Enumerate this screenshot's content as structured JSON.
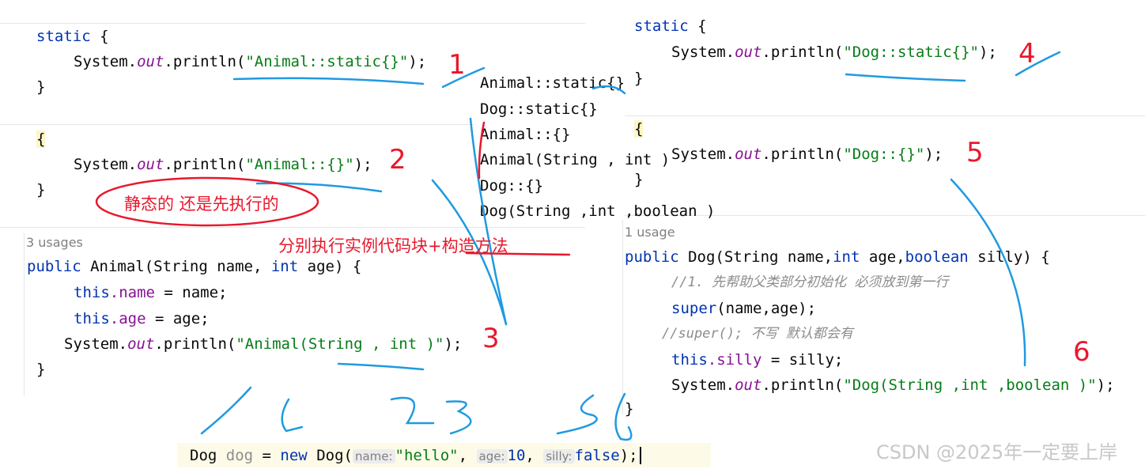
{
  "left": {
    "static_block": {
      "kw": "static",
      "open": " {",
      "sys": "System.",
      "out": "out",
      "println": ".println(",
      "str": "\"Animal::static{}\"",
      "end": ");",
      "close": "}"
    },
    "instance_block": {
      "open": "{",
      "sys": "System.",
      "out": "out",
      "println": ".println(",
      "str": "\"Animal::{}\"",
      "end": ");",
      "close": "}"
    },
    "usages": "3 usages",
    "ctor": {
      "kw_public": "public",
      "name": " Animal(String name, ",
      "kw_int": "int",
      "rest": " age) {",
      "l1_this": "this",
      "l1_field": ".name",
      "l1_rest": " = name;",
      "l2_this": "this",
      "l2_field": ".age",
      "l2_rest": " = age;",
      "sys": "System.",
      "out": "out",
      "println": ".println(",
      "str": "\"Animal(String , int )\"",
      "end": ");",
      "close": "}"
    }
  },
  "output": [
    "Animal::static{}",
    "Dog::static{}",
    "Animal::{}",
    "Animal(String , int )",
    "Dog::{}",
    "Dog(String ,int ,boolean )"
  ],
  "right": {
    "static_block": {
      "kw": "static",
      "open": " {",
      "sys": "System.",
      "out": "out",
      "println": ".println(",
      "str": "\"Dog::static{}\"",
      "end": ");",
      "close": "}"
    },
    "instance_block": {
      "open": "{",
      "sys": "System.",
      "out": "out",
      "println": ".println(",
      "str": "\"Dog::{}\"",
      "end": ");",
      "close": "}"
    },
    "usages": "1 usage",
    "ctor": {
      "kw_public": "public",
      "name": " Dog(String name,",
      "kw_int": "int",
      "mid": " age,",
      "kw_bool": "boolean",
      "rest": " silly) {",
      "comment1": "//1. 先帮助父类部分初始化 必须放到第一行",
      "super_kw": "super",
      "super_rest": "(name,age);",
      "comment2": "//super(); 不写 默认都会有",
      "this_kw": "this",
      "field": ".silly",
      "assign": " = silly;",
      "sys": "System.",
      "out": "out",
      "println": ".println(",
      "str": "\"Dog(String ,int ,boolean )\"",
      "end": ");",
      "close": "}"
    }
  },
  "call": {
    "type": "Dog",
    "var": " dog",
    "eq": " = ",
    "kw_new": "new",
    "cls": " Dog(",
    "hint1": "name:",
    "arg1": "\"hello\"",
    "comma1": ",",
    "hint2": "age:",
    "arg2": "10",
    "comma2": ",",
    "hint3": "silly:",
    "arg3": "false",
    "end": ");"
  },
  "annotations": {
    "static_first": "静态的 还是先执行的",
    "instance_then_ctor": "分别执行实例代码块+构造方法",
    "num1": "1",
    "num2": "2",
    "num3": "3",
    "num4": "4",
    "num5": "5",
    "num6": "6",
    "order_left": "1",
    "order_mid": "4",
    "order_right": "2 3",
    "order_far": "5 6"
  },
  "watermark": "CSDN @2025年一定要上岸",
  "colors": {
    "keyword": "#0033b3",
    "field": "#871094",
    "string": "#067d17",
    "comment": "#8c8c8c",
    "note_red": "#e8182c",
    "note_blue": "#1f9ae0"
  }
}
